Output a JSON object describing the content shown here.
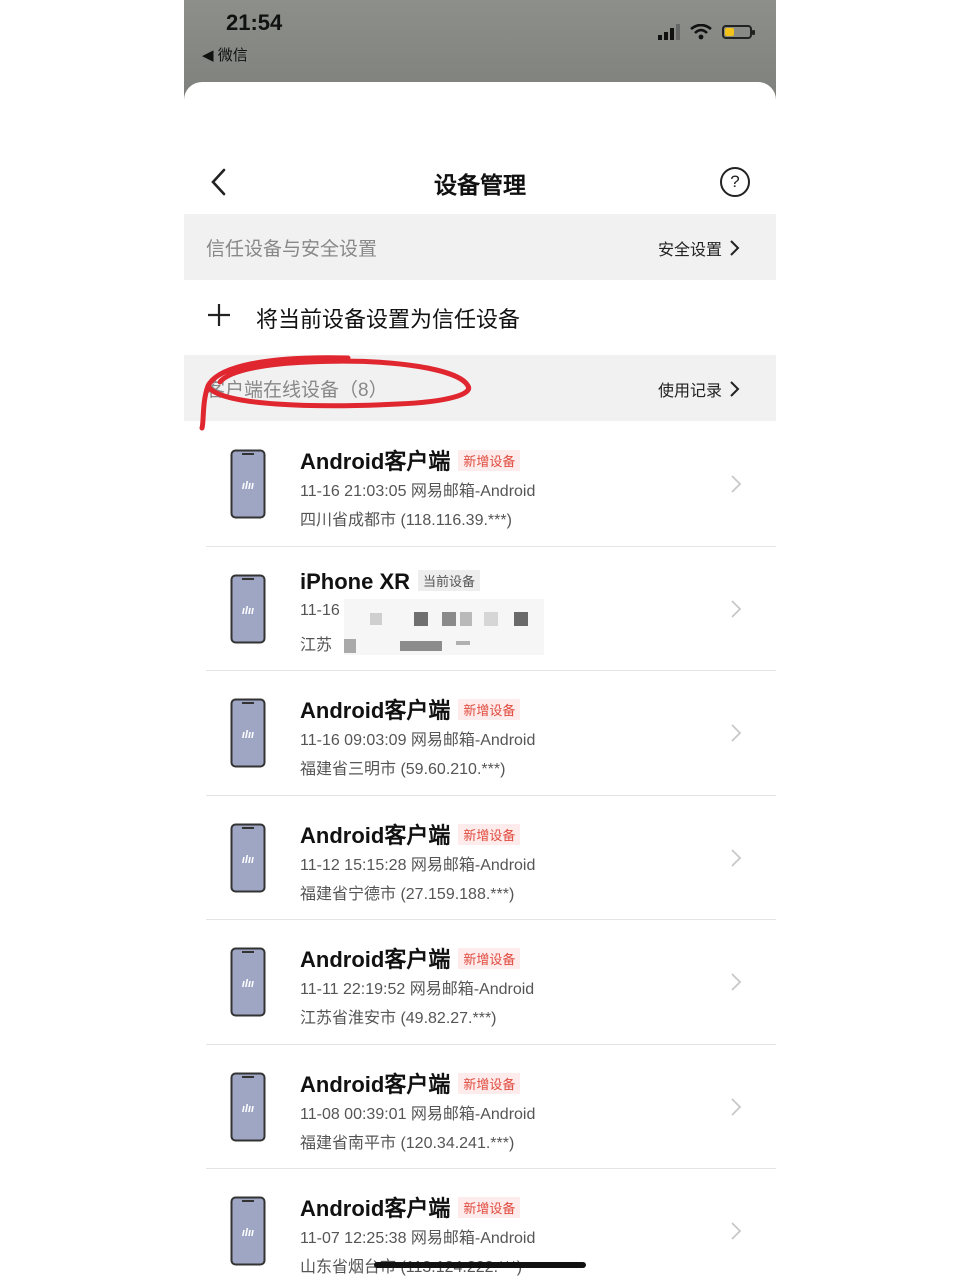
{
  "status_bar": {
    "time": "21:54",
    "back_app": "◀ 微信"
  },
  "navbar": {
    "title": "设备管理",
    "help_symbol": "?"
  },
  "trusted_section": {
    "title": "信任设备与安全设置",
    "link_label": "安全设置"
  },
  "add_trusted": {
    "label": "将当前设备设置为信任设备"
  },
  "online_section": {
    "title": "客户端在线设备（8）",
    "link_label": "使用记录"
  },
  "devices": [
    {
      "name": "Android客户端",
      "badge": "新增设备",
      "time": "11-16 21:03:05 网易邮箱-Android",
      "location": "四川省成都市 (118.116.39.***)"
    },
    {
      "name": "iPhone XR",
      "badge": "当前设备",
      "time": "11-16",
      "location": "江苏"
    },
    {
      "name": "Android客户端",
      "badge": "新增设备",
      "time": "11-16 09:03:09 网易邮箱-Android",
      "location": "福建省三明市 (59.60.210.***)"
    },
    {
      "name": "Android客户端",
      "badge": "新增设备",
      "time": "11-12 15:15:28 网易邮箱-Android",
      "location": "福建省宁德市 (27.159.188.***)"
    },
    {
      "name": "Android客户端",
      "badge": "新增设备",
      "time": "11-11 22:19:52 网易邮箱-Android",
      "location": "江苏省淮安市 (49.82.27.***)"
    },
    {
      "name": "Android客户端",
      "badge": "新增设备",
      "time": "11-08 00:39:01 网易邮箱-Android",
      "location": "福建省南平市 (120.34.241.***)"
    },
    {
      "name": "Android客户端",
      "badge": "新增设备",
      "time": "11-07 12:25:38 网易邮箱-Android",
      "location": "山东省烟台市 (113.124.222.***)"
    }
  ],
  "colors": {
    "accent_red": "#e04b3f",
    "annotation_red": "#e0262f",
    "section_bg": "#f1f1f1"
  }
}
